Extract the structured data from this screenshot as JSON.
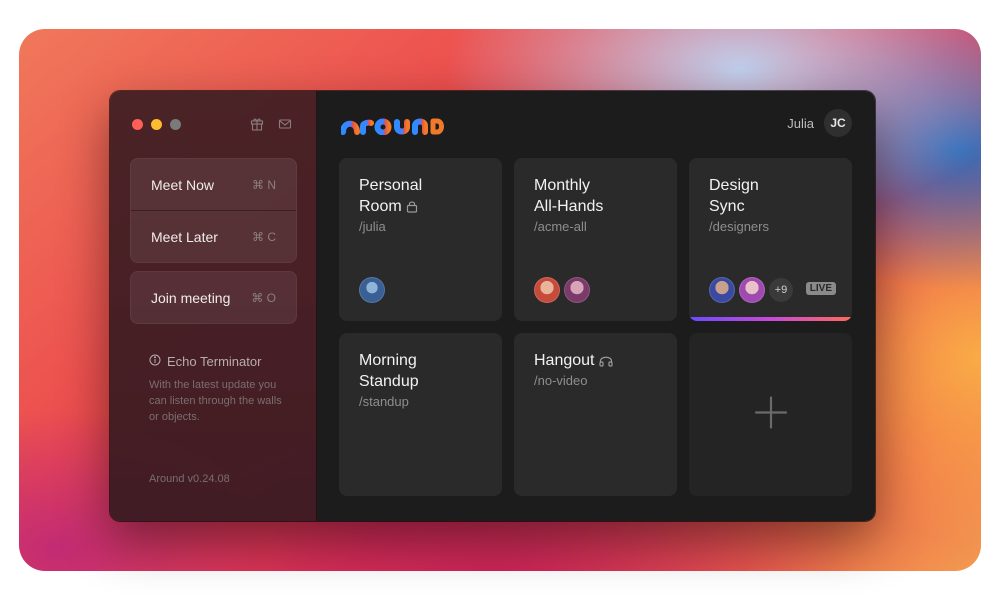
{
  "app": {
    "logo_text": "around",
    "colors": {
      "accent": "#3b8bff",
      "logo_orange": "#f05a2a"
    }
  },
  "sidebar": {
    "icons": [
      "gift-icon",
      "mail-icon"
    ],
    "meet_now": {
      "label": "Meet Now",
      "shortcut": "⌘ N"
    },
    "meet_later": {
      "label": "Meet Later",
      "shortcut": "⌘ C"
    },
    "join": {
      "label": "Join meeting",
      "shortcut": "⌘ O"
    },
    "info": {
      "title": "Echo Terminator",
      "text": "With the latest update you can listen through the walls or objects."
    },
    "version": "Around v0.24.08"
  },
  "user": {
    "name": "Julia",
    "initials": "JC"
  },
  "rooms": [
    {
      "title": "Personal\nRoom",
      "slug": "/julia",
      "icon": "lock-icon"
    },
    {
      "title": "Monthly\nAll-Hands",
      "slug": "/acme-all"
    },
    {
      "title": "Design\nSync",
      "slug": "/designers",
      "more": "+9",
      "badge": "LIVE"
    },
    {
      "title": "Morning\nStandup",
      "slug": "/standup"
    },
    {
      "title": "Hangout",
      "slug": "/no-video",
      "icon": "headphones-icon"
    }
  ]
}
